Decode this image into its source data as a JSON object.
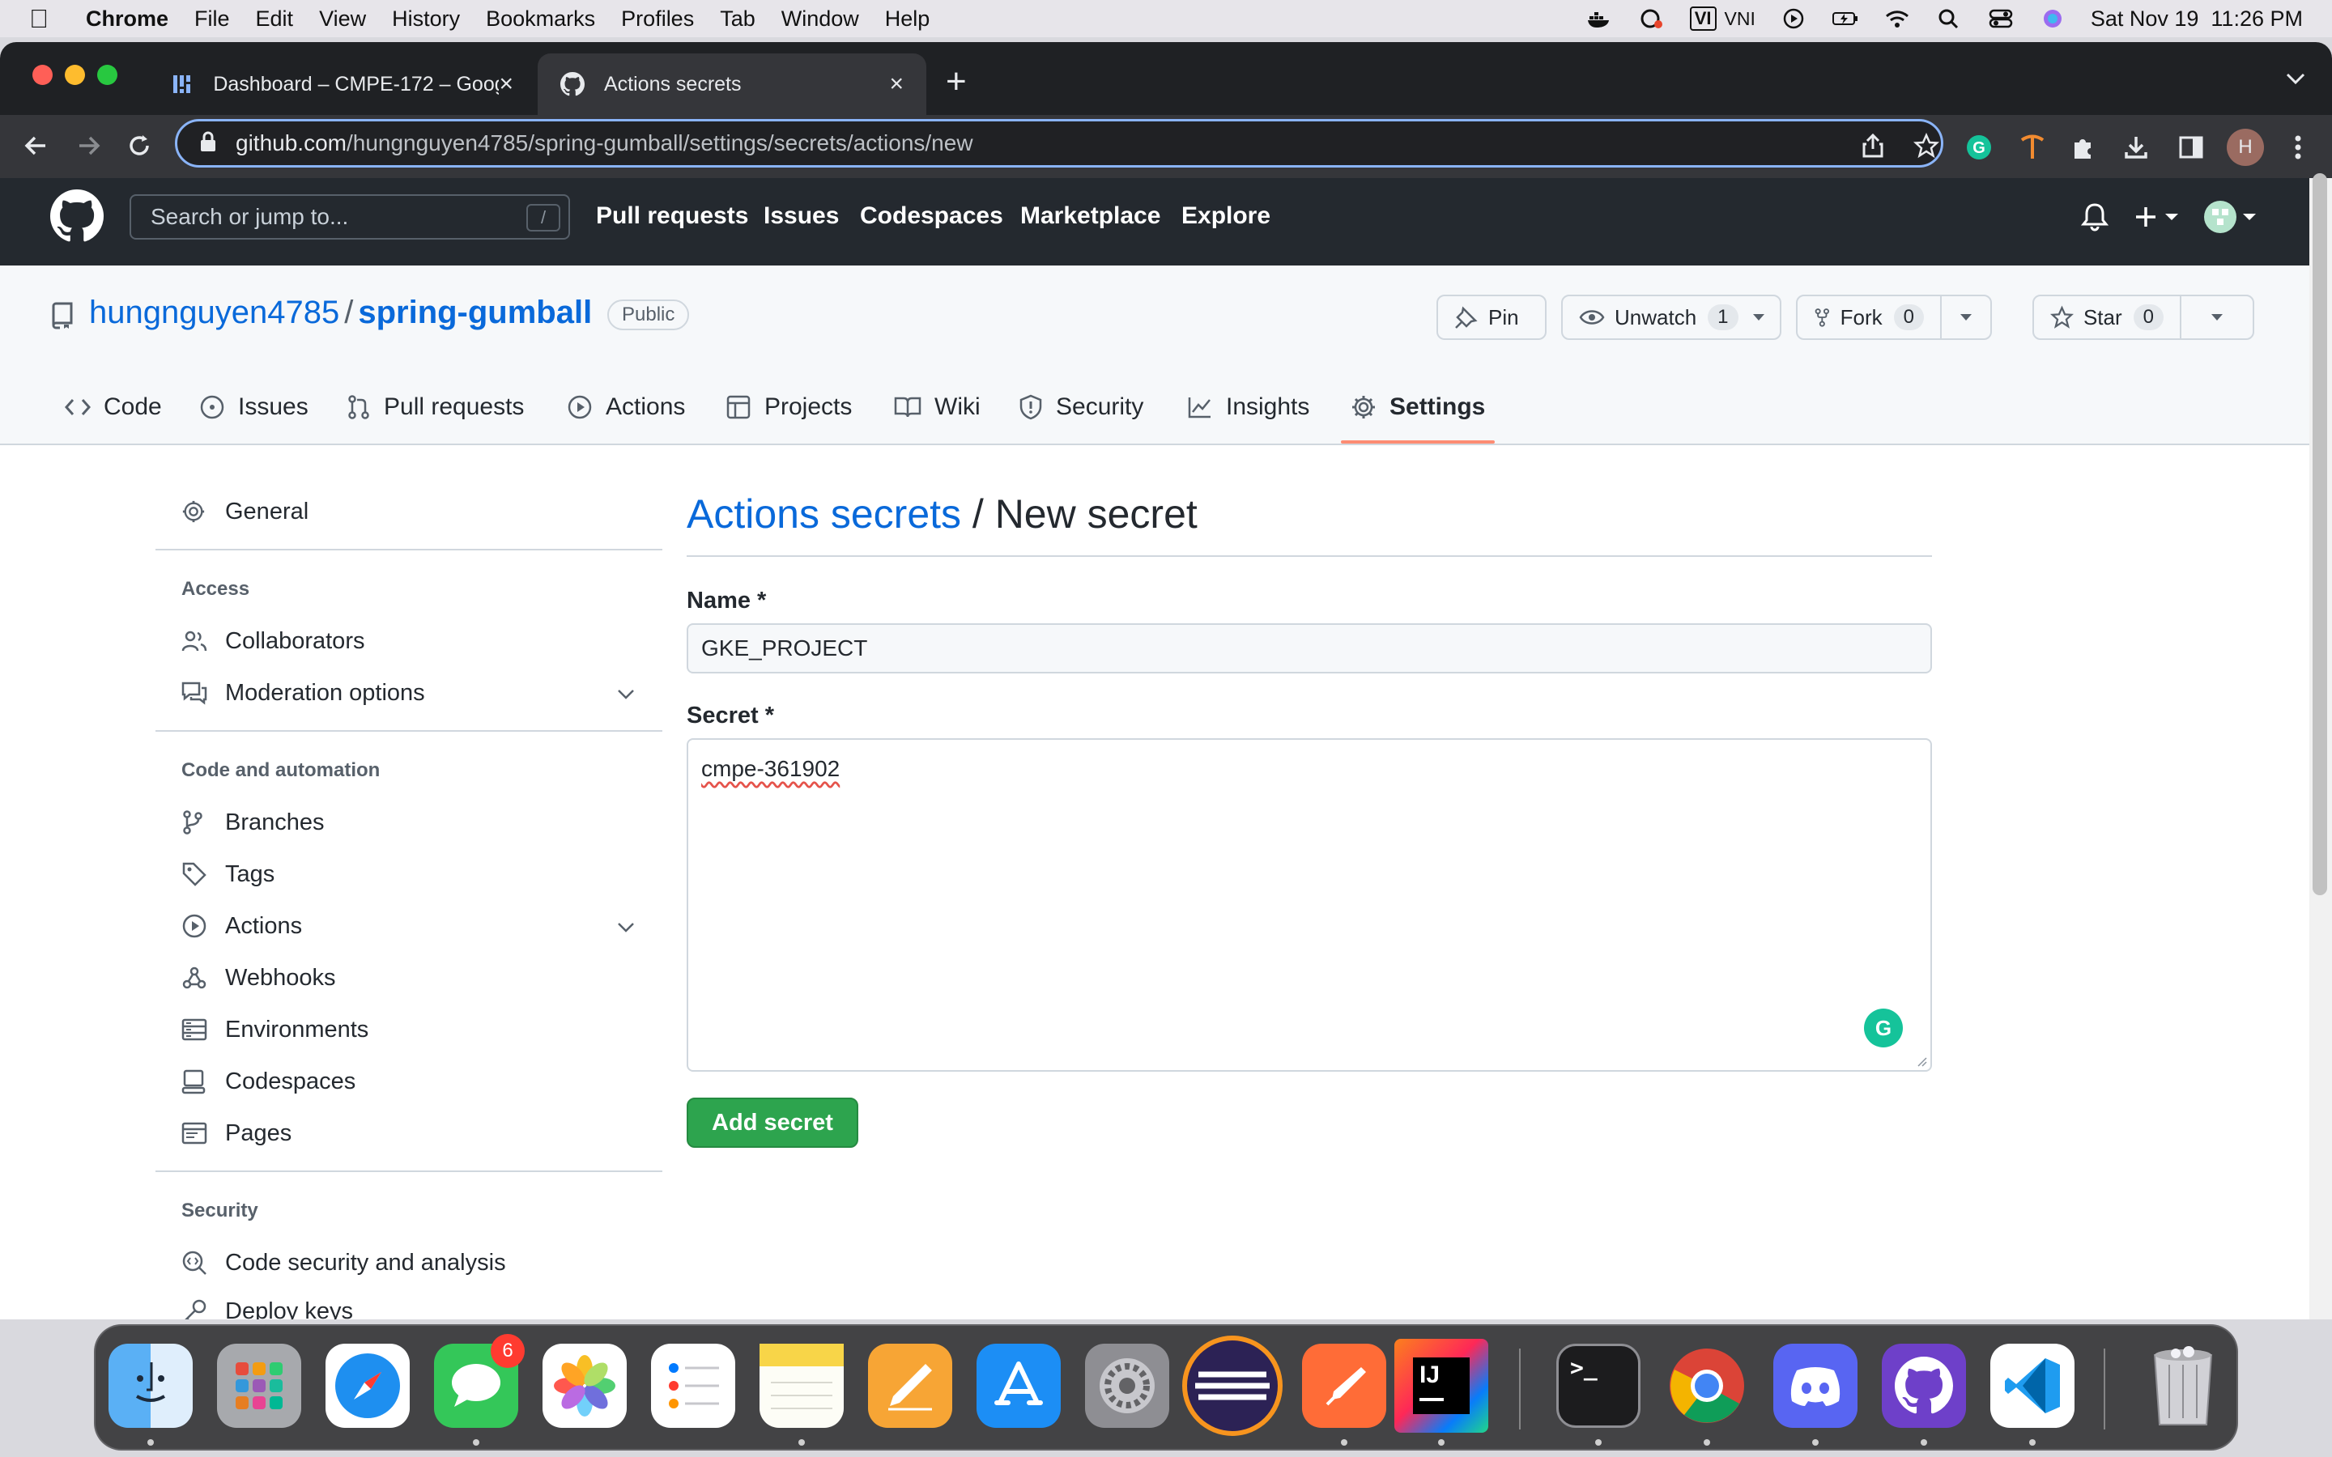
{
  "menubar": {
    "app_name": "Chrome",
    "items": [
      "File",
      "Edit",
      "View",
      "History",
      "Bookmarks",
      "Profiles",
      "Tab",
      "Window",
      "Help"
    ],
    "input_method": "VNI",
    "input_badge": "VI",
    "datetime": "Sat Nov 19  11:26 PM"
  },
  "browser": {
    "tabs": [
      {
        "title": "Dashboard – CMPE-172 – Goog",
        "icon": "google-cloud-dashboard-icon",
        "active": false
      },
      {
        "title": "Actions secrets",
        "icon": "github-icon",
        "active": true
      }
    ],
    "url_host": "github.com",
    "url_path": "/hungnguyen4785/spring-gumball/settings/secrets/actions/new",
    "profile_initial": "H"
  },
  "github": {
    "search_placeholder": "Search or jump to...",
    "search_shortcut": "/",
    "nav": [
      "Pull requests",
      "Issues",
      "Codespaces",
      "Marketplace",
      "Explore"
    ]
  },
  "repo": {
    "owner": "hungnguyen4785",
    "separator": "/",
    "name": "spring-gumball",
    "visibility": "Public",
    "pin_label": "Pin",
    "watch_label": "Unwatch",
    "watch_count": "1",
    "fork_label": "Fork",
    "fork_count": "0",
    "star_label": "Star",
    "star_count": "0",
    "tabs": [
      "Code",
      "Issues",
      "Pull requests",
      "Actions",
      "Projects",
      "Wiki",
      "Security",
      "Insights",
      "Settings"
    ],
    "selected_tab": "Settings"
  },
  "sidebar": {
    "general": "General",
    "access_heading": "Access",
    "access_items": [
      "Collaborators",
      "Moderation options"
    ],
    "code_heading": "Code and automation",
    "code_items": [
      "Branches",
      "Tags",
      "Actions",
      "Webhooks",
      "Environments",
      "Codespaces",
      "Pages"
    ],
    "security_heading": "Security",
    "security_items": [
      "Code security and analysis",
      "Deploy keys"
    ]
  },
  "form": {
    "breadcrumb": "Actions secrets",
    "title_rest": " / New secret",
    "name_label": "Name *",
    "name_value": "GKE_PROJECT",
    "secret_label": "Secret *",
    "secret_value": "cmpe-361902",
    "submit_label": "Add secret",
    "grammarly_letter": "G"
  },
  "dock": {
    "apps": [
      "Finder",
      "Launchpad",
      "Safari",
      "Messages",
      "Photos",
      "Reminders",
      "Notes",
      "Pages",
      "App Store",
      "System Preferences",
      "Eclipse",
      "Postman",
      "IntelliJ IDEA",
      "Terminal",
      "Google Chrome",
      "Discord",
      "GitHub Desktop",
      "Visual Studio Code",
      "Trash"
    ],
    "messages_badge": "6",
    "intellij_letters": "IJ",
    "terminal_prompt": ">_"
  },
  "colors": {
    "link": "#0969da",
    "primary_button": "#2da44e",
    "selected_tab_underline": "#fd8c73",
    "github_header": "#24292f"
  }
}
